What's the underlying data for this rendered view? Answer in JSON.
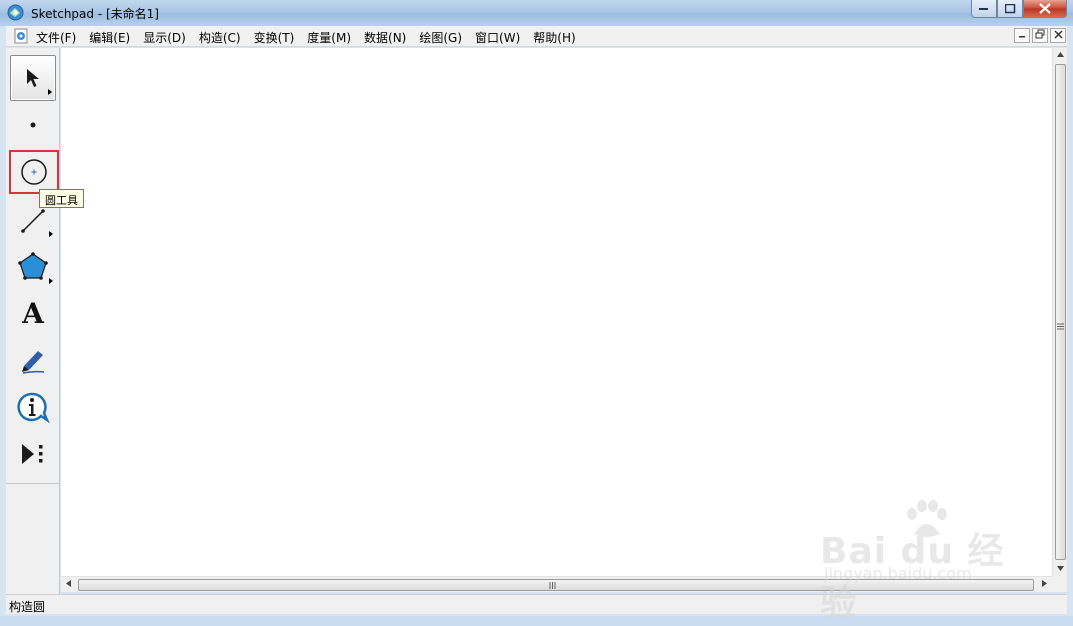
{
  "window": {
    "title": "Sketchpad  - [未命名1]"
  },
  "menubar": {
    "items": [
      {
        "label": "文件(F)"
      },
      {
        "label": "编辑(E)"
      },
      {
        "label": "显示(D)"
      },
      {
        "label": "构造(C)"
      },
      {
        "label": "变换(T)"
      },
      {
        "label": "度量(M)"
      },
      {
        "label": "数据(N)"
      },
      {
        "label": "绘图(G)"
      },
      {
        "label": "窗口(W)"
      },
      {
        "label": "帮助(H)"
      }
    ]
  },
  "toolbox": {
    "tools": [
      {
        "name": "selection-arrow-tool",
        "selected": true,
        "has_submenu": true
      },
      {
        "name": "point-tool",
        "selected": false,
        "has_submenu": false
      },
      {
        "name": "compass-circle-tool",
        "selected": false,
        "has_submenu": false,
        "highlighted": true
      },
      {
        "name": "straightedge-tool",
        "selected": false,
        "has_submenu": true
      },
      {
        "name": "polygon-tool",
        "selected": false,
        "has_submenu": true
      },
      {
        "name": "text-tool",
        "selected": false,
        "has_submenu": false
      },
      {
        "name": "marker-tool",
        "selected": false,
        "has_submenu": false
      },
      {
        "name": "information-tool",
        "selected": false,
        "has_submenu": false
      },
      {
        "name": "custom-tool",
        "selected": false,
        "has_submenu": false
      }
    ],
    "tooltip": "圆工具",
    "text_tool_glyph": "A"
  },
  "statusbar": {
    "text": "构造圆"
  },
  "watermark": {
    "logo": "Bai du 经验",
    "url": "jingyan.baidu.com"
  },
  "colors": {
    "highlight_border": "#d3353a",
    "polygon_fill": "#2a8fd6",
    "marker_color": "#2f5fa8",
    "info_color": "#1a6fb0"
  }
}
